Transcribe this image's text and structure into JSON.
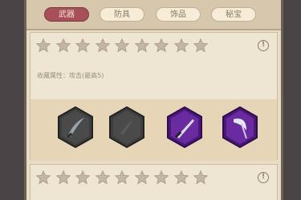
{
  "tabs": [
    {
      "label": "武器",
      "active": true
    },
    {
      "label": "防具",
      "active": false
    },
    {
      "label": "饰品",
      "active": false
    },
    {
      "label": "秘宝",
      "active": false
    }
  ],
  "sections": [
    {
      "stars_total": 9,
      "stars_filled": 0,
      "info_icon": "info-icon",
      "attribute_text": "收藏属性：攻击(最高5)",
      "weapons": [
        {
          "icon": "curved-sword-icon",
          "tier": "gray"
        },
        {
          "icon": "curved-sword-icon",
          "tier": "gray"
        },
        {
          "icon": "dagger-icon",
          "tier": "purple"
        },
        {
          "icon": "scythe-icon",
          "tier": "purple"
        }
      ]
    },
    {
      "stars_total": 9,
      "stars_filled": 0,
      "info_icon": "info-icon"
    }
  ],
  "colors": {
    "tab_active": "#a8505a",
    "gray_tier": "#4a4a4a",
    "purple_tier": "#6a2aa0"
  }
}
